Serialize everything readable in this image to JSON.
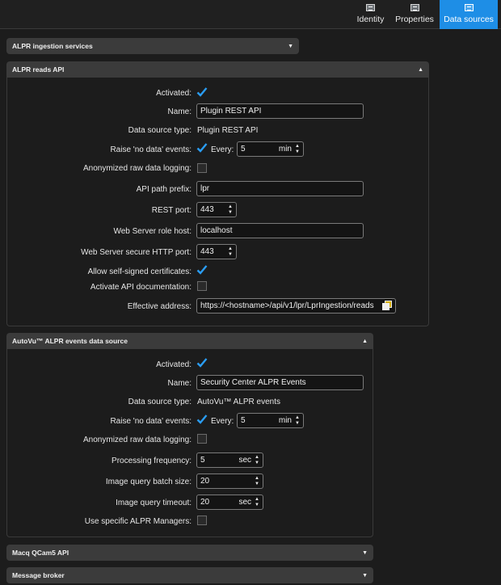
{
  "tabs": [
    {
      "label": "Identity",
      "icon": "identity-icon",
      "active": false
    },
    {
      "label": "Properties",
      "icon": "properties-icon",
      "active": false
    },
    {
      "label": "Data sources",
      "icon": "data-sources-icon",
      "active": true
    }
  ],
  "colors": {
    "accent": "#1e8ee6",
    "check": "#2a9df4",
    "header": "#3b3b3b"
  },
  "sections": {
    "alpr_ingestion": {
      "title": "ALPR ingestion services",
      "expanded": false
    },
    "alpr_reads_api": {
      "title": "ALPR reads API",
      "expanded": true,
      "activated_label": "Activated:",
      "name_label": "Name:",
      "name_value": "Plugin REST API",
      "ds_type_label": "Data source type:",
      "ds_type_value": "Plugin REST API",
      "raise_label": "Raise 'no data' events:",
      "every_label": "Every:",
      "every_value": "5",
      "every_unit": "min",
      "anon_label": "Anonymized raw data logging:",
      "api_prefix_label": "API path prefix:",
      "api_prefix_value": "lpr",
      "rest_port_label": "REST port:",
      "rest_port_value": "443",
      "ws_host_label": "Web Server role host:",
      "ws_host_value": "localhost",
      "ws_port_label": "Web Server secure HTTP port:",
      "ws_port_value": "443",
      "self_signed_label": "Allow self-signed certificates:",
      "api_doc_label": "Activate API documentation:",
      "eff_addr_label": "Effective address:",
      "eff_addr_value": "https://<hostname>/api/v1/lpr/LprIngestion/reads"
    },
    "autovu": {
      "title": "AutoVu™ ALPR events data source",
      "expanded": true,
      "activated_label": "Activated:",
      "name_label": "Name:",
      "name_value": "Security Center ALPR Events",
      "ds_type_label": "Data source type:",
      "ds_type_value": "AutoVu™ ALPR events",
      "raise_label": "Raise 'no data' events:",
      "every_label": "Every:",
      "every_value": "5",
      "every_unit": "min",
      "anon_label": "Anonymized raw data logging:",
      "proc_freq_label": "Processing frequency:",
      "proc_freq_value": "5",
      "proc_freq_unit": "sec",
      "batch_label": "Image query batch size:",
      "batch_value": "20",
      "timeout_label": "Image query timeout:",
      "timeout_value": "20",
      "timeout_unit": "sec",
      "managers_label": "Use specific ALPR Managers:"
    },
    "macq": {
      "title": "Macq QCam5 API",
      "expanded": false
    },
    "broker": {
      "title": "Message broker",
      "expanded": false
    }
  }
}
